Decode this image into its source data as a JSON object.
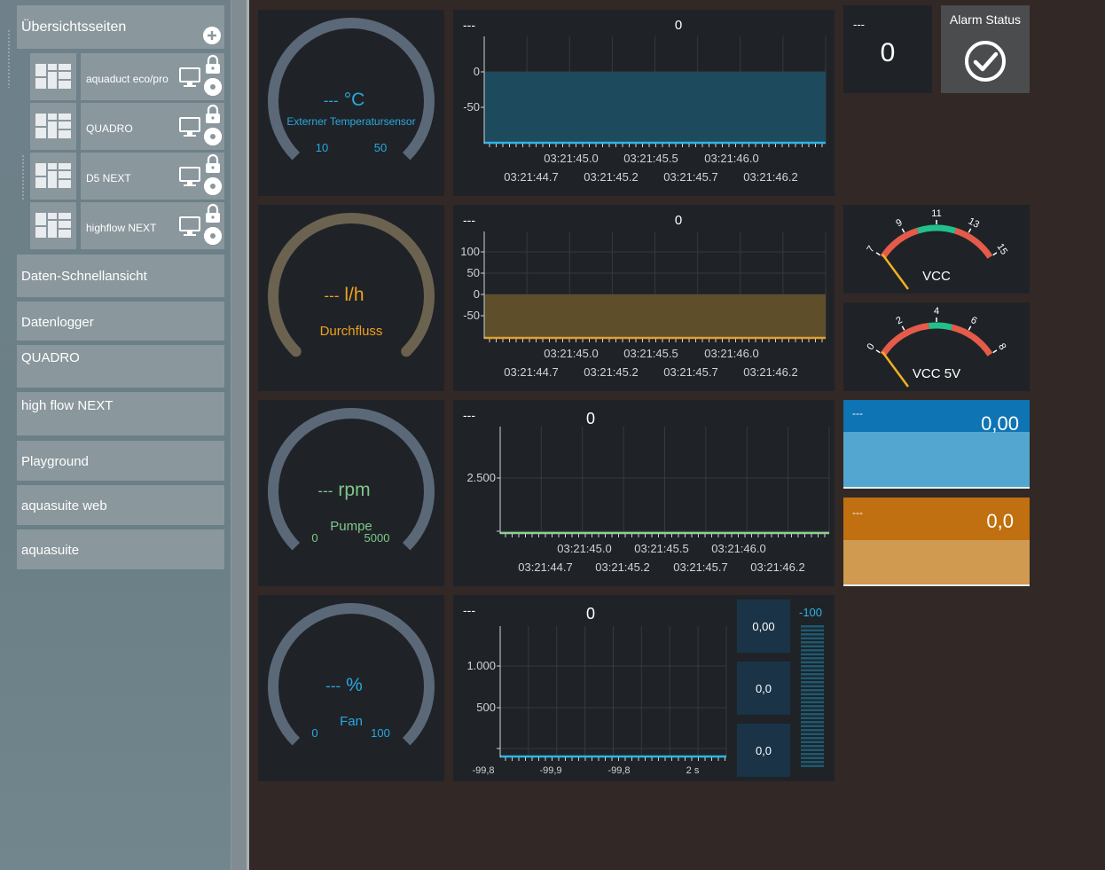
{
  "sidebar": {
    "header": "Übersichtsseiten",
    "subpages": [
      {
        "label": "aquaduct eco/pro"
      },
      {
        "label": "QUADRO"
      },
      {
        "label": "D5 NEXT"
      },
      {
        "label": "highflow NEXT"
      }
    ],
    "items": [
      {
        "label": "Daten-Schnellansicht"
      },
      {
        "label": "Datenlogger"
      },
      {
        "label": "QUADRO"
      },
      {
        "label": "high flow NEXT"
      },
      {
        "label": "Playground"
      },
      {
        "label": "aquasuite web"
      },
      {
        "label": "aquasuite"
      }
    ]
  },
  "gauges": [
    {
      "value": "---",
      "unit": "°C",
      "label": "Externer Temperatursensor",
      "min": "10",
      "max": "50",
      "color": "#29a8e0",
      "arc_color": "#5b6878",
      "level": null
    },
    {
      "value": "---",
      "unit": "l/h",
      "label": "Durchfluss",
      "min": "",
      "max": "",
      "color": "#f0a020",
      "arc_color": "#6b6250",
      "level": null
    },
    {
      "value": "---",
      "unit": "rpm",
      "label": "Pumpe",
      "min": "0",
      "max": "5000",
      "color": "#7fc88a",
      "arc_color": "#5b6878",
      "level": null
    },
    {
      "value": "---",
      "unit": "%",
      "label": "Fan",
      "min": "0",
      "max": "100",
      "color": "#29a8e0",
      "arc_color": "#5b6878",
      "level": null
    }
  ],
  "charts": [
    {
      "header_left": "---",
      "header_value": "0",
      "yticks": [
        "0",
        "-50"
      ],
      "xticks_top": [
        "03:21:45.0",
        "03:21:45.5",
        "03:21:46.0"
      ],
      "xticks_bottom": [
        "03:21:44.7",
        "03:21:45.2",
        "03:21:45.7",
        "03:21:46.2"
      ],
      "color": "#2bb5e8"
    },
    {
      "header_left": "---",
      "header_value": "0",
      "yticks": [
        "100",
        "50",
        "0",
        "-50"
      ],
      "xticks_top": [
        "03:21:45.0",
        "03:21:45.5",
        "03:21:46.0"
      ],
      "xticks_bottom": [
        "03:21:44.7",
        "03:21:45.2",
        "03:21:45.7",
        "03:21:46.2"
      ],
      "color": "#e0a030"
    },
    {
      "header_left": "---",
      "header_value": "0",
      "yticks": [
        "2.500",
        ""
      ],
      "xticks_top": [
        "03:21:45.0",
        "03:21:45.5",
        "03:21:46.0"
      ],
      "xticks_bottom": [
        "03:21:44.7",
        "03:21:45.2",
        "03:21:45.7",
        "03:21:46.2"
      ],
      "color": "#8fd08f"
    },
    {
      "header_left": "---",
      "header_value": "0",
      "yticks": [
        "1.000",
        "500",
        ""
      ],
      "xticks_bottom": [
        "-99,8",
        "-99,9",
        "-99,8",
        "2 s"
      ],
      "color": "#2bb5e8"
    }
  ],
  "fan_values": [
    "0,00",
    "0,0",
    "0,0"
  ],
  "fan_scale_label": "-100",
  "tiles": {
    "counter": {
      "header": "---",
      "value": "0"
    },
    "alarm": {
      "title": "Alarm Status"
    },
    "vcc": {
      "label": "VCC",
      "ticks": [
        "7",
        "9",
        "11",
        "13",
        "15"
      ]
    },
    "vcc5": {
      "label": "VCC 5V",
      "ticks": [
        "0",
        "2",
        "4",
        "6",
        "8"
      ]
    },
    "blue": {
      "header": "---",
      "value": "0,00",
      "color": "#0e74b4",
      "fill_color": "#52a6cf"
    },
    "orange": {
      "header": "---",
      "value": "0,0",
      "color": "#c07010",
      "fill_color": "#d09a50"
    }
  }
}
